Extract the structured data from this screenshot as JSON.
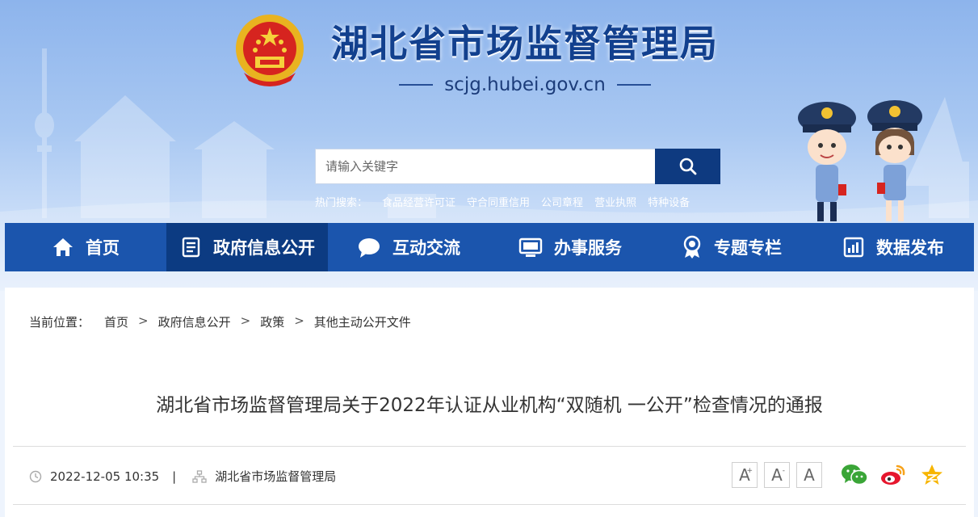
{
  "header": {
    "site_title": "湖北省市场监督管理局",
    "domain": "scjg.hubei.gov.cn"
  },
  "search": {
    "placeholder": "请输入关键字",
    "hot_label": "热门搜索：",
    "hot_keywords": [
      "食品经营许可证",
      "守合同重信用",
      "公司章程",
      "营业执照",
      "特种设备"
    ]
  },
  "nav": [
    {
      "label": "首页",
      "icon": "home-icon"
    },
    {
      "label": "政府信息公开",
      "icon": "document-list-icon"
    },
    {
      "label": "互动交流",
      "icon": "chat-bubble-icon"
    },
    {
      "label": "办事服务",
      "icon": "monitor-icon"
    },
    {
      "label": "专题专栏",
      "icon": "award-badge-icon"
    },
    {
      "label": "数据发布",
      "icon": "bar-chart-icon"
    }
  ],
  "nav_active_index": 1,
  "breadcrumb": {
    "label": "当前位置：",
    "items": [
      "首页",
      "政府信息公开",
      "政策",
      "其他主动公开文件"
    ],
    "separator": ">"
  },
  "article": {
    "title": "湖北省市场监督管理局关于2022年认证从业机构“双随机 一公开”检查情况的通报",
    "datetime": "2022-12-05 10:35",
    "meta_separator": "|",
    "source": "湖北省市场监督管理局"
  },
  "font_controls": [
    "A",
    "A",
    "A"
  ],
  "font_controls_marks": [
    "+",
    "-",
    ""
  ],
  "share": [
    {
      "icon": "wechat-icon",
      "color": "#3aa537"
    },
    {
      "icon": "weibo-icon",
      "color": "#e6162d"
    },
    {
      "icon": "qzone-star-icon",
      "color": "#f7b500"
    }
  ],
  "colors": {
    "nav_bg": "#1b55ad",
    "nav_active": "#0c3b82",
    "title_blue": "#12408e",
    "search_button": "#0e3a80"
  }
}
